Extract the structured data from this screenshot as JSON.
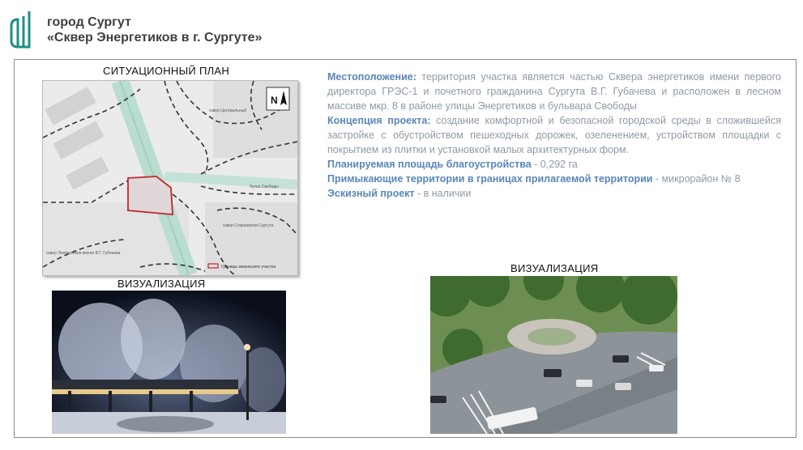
{
  "header": {
    "line1": "город Сургут",
    "line2": "«Сквер Энергетиков в г. Сургуте»"
  },
  "colors": {
    "accent": "#1f8f86",
    "heading": "#5a86b8",
    "body_text": "#8f9aa6"
  },
  "captions": {
    "situation_plan": "СИТУАЦИОННЫЙ  ПЛАН",
    "visualization_left": "ВИЗУАЛИЗАЦИЯ",
    "visualization_right": "ВИЗУАЛИЗАЦИЯ"
  },
  "map": {
    "north_label": "N",
    "park_central": "сквер Центральный",
    "street": "бульв.Свободы",
    "park_starozhilov": "сквер Старожилов Сургута",
    "park_energetikov": "сквер Энергетиков имени В.Г. Губчаева",
    "legend": "Границы земельного участка"
  },
  "info": {
    "location_label": "Местоположение:",
    "location_text": " территория участка является частью Сквера энергетиков имени первого директора ГРЭС-1 и почетного гражданина Сургута В.Г. Губачева и расположен в лесном массиве мкр. 8 в районе улицы Энергетиков и бульвара Свободы",
    "concept_label": "Концепция проекта:",
    "concept_text": " создание комфортной и безопасной городской среды в сложившейся застройке с обустройством пешеходных дорожек, озеленением, устройством площадки с покрытием из плитки и установкой малых архитектурных форм.",
    "area_label": "Планируемая площадь благоустройства",
    "area_text": " -  0,292 га",
    "adjacent_label": "Примыкающие  территории в границах прилагаемой  территории",
    "adjacent_text": " - микрорайон № 8",
    "sketch_label": "Эскизный проект",
    "sketch_text": " - в наличии"
  }
}
